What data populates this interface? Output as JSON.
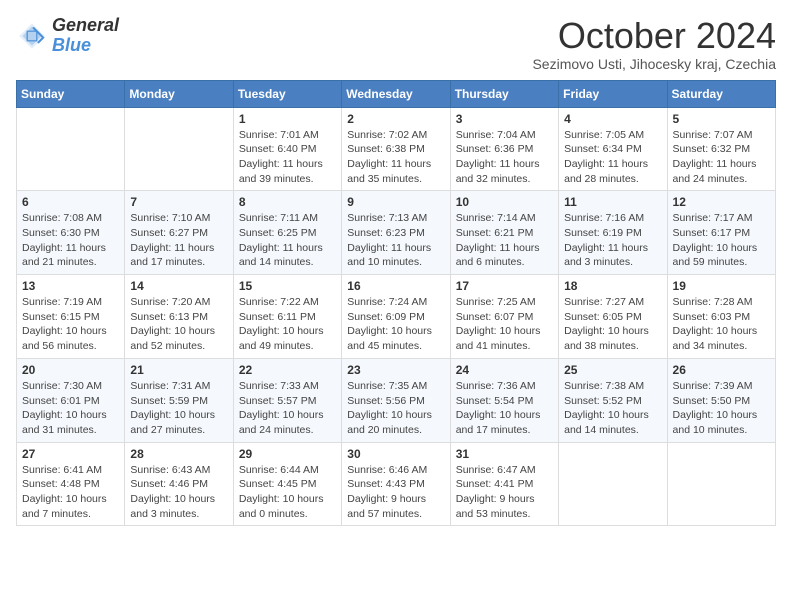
{
  "header": {
    "logo_line1": "General",
    "logo_line2": "Blue",
    "month_title": "October 2024",
    "subtitle": "Sezimovo Usti, Jihocesky kraj, Czechia"
  },
  "weekdays": [
    "Sunday",
    "Monday",
    "Tuesday",
    "Wednesday",
    "Thursday",
    "Friday",
    "Saturday"
  ],
  "weeks": [
    [
      {
        "day": "",
        "info": ""
      },
      {
        "day": "",
        "info": ""
      },
      {
        "day": "1",
        "info": "Sunrise: 7:01 AM\nSunset: 6:40 PM\nDaylight: 11 hours and 39 minutes."
      },
      {
        "day": "2",
        "info": "Sunrise: 7:02 AM\nSunset: 6:38 PM\nDaylight: 11 hours and 35 minutes."
      },
      {
        "day": "3",
        "info": "Sunrise: 7:04 AM\nSunset: 6:36 PM\nDaylight: 11 hours and 32 minutes."
      },
      {
        "day": "4",
        "info": "Sunrise: 7:05 AM\nSunset: 6:34 PM\nDaylight: 11 hours and 28 minutes."
      },
      {
        "day": "5",
        "info": "Sunrise: 7:07 AM\nSunset: 6:32 PM\nDaylight: 11 hours and 24 minutes."
      }
    ],
    [
      {
        "day": "6",
        "info": "Sunrise: 7:08 AM\nSunset: 6:30 PM\nDaylight: 11 hours and 21 minutes."
      },
      {
        "day": "7",
        "info": "Sunrise: 7:10 AM\nSunset: 6:27 PM\nDaylight: 11 hours and 17 minutes."
      },
      {
        "day": "8",
        "info": "Sunrise: 7:11 AM\nSunset: 6:25 PM\nDaylight: 11 hours and 14 minutes."
      },
      {
        "day": "9",
        "info": "Sunrise: 7:13 AM\nSunset: 6:23 PM\nDaylight: 11 hours and 10 minutes."
      },
      {
        "day": "10",
        "info": "Sunrise: 7:14 AM\nSunset: 6:21 PM\nDaylight: 11 hours and 6 minutes."
      },
      {
        "day": "11",
        "info": "Sunrise: 7:16 AM\nSunset: 6:19 PM\nDaylight: 11 hours and 3 minutes."
      },
      {
        "day": "12",
        "info": "Sunrise: 7:17 AM\nSunset: 6:17 PM\nDaylight: 10 hours and 59 minutes."
      }
    ],
    [
      {
        "day": "13",
        "info": "Sunrise: 7:19 AM\nSunset: 6:15 PM\nDaylight: 10 hours and 56 minutes."
      },
      {
        "day": "14",
        "info": "Sunrise: 7:20 AM\nSunset: 6:13 PM\nDaylight: 10 hours and 52 minutes."
      },
      {
        "day": "15",
        "info": "Sunrise: 7:22 AM\nSunset: 6:11 PM\nDaylight: 10 hours and 49 minutes."
      },
      {
        "day": "16",
        "info": "Sunrise: 7:24 AM\nSunset: 6:09 PM\nDaylight: 10 hours and 45 minutes."
      },
      {
        "day": "17",
        "info": "Sunrise: 7:25 AM\nSunset: 6:07 PM\nDaylight: 10 hours and 41 minutes."
      },
      {
        "day": "18",
        "info": "Sunrise: 7:27 AM\nSunset: 6:05 PM\nDaylight: 10 hours and 38 minutes."
      },
      {
        "day": "19",
        "info": "Sunrise: 7:28 AM\nSunset: 6:03 PM\nDaylight: 10 hours and 34 minutes."
      }
    ],
    [
      {
        "day": "20",
        "info": "Sunrise: 7:30 AM\nSunset: 6:01 PM\nDaylight: 10 hours and 31 minutes."
      },
      {
        "day": "21",
        "info": "Sunrise: 7:31 AM\nSunset: 5:59 PM\nDaylight: 10 hours and 27 minutes."
      },
      {
        "day": "22",
        "info": "Sunrise: 7:33 AM\nSunset: 5:57 PM\nDaylight: 10 hours and 24 minutes."
      },
      {
        "day": "23",
        "info": "Sunrise: 7:35 AM\nSunset: 5:56 PM\nDaylight: 10 hours and 20 minutes."
      },
      {
        "day": "24",
        "info": "Sunrise: 7:36 AM\nSunset: 5:54 PM\nDaylight: 10 hours and 17 minutes."
      },
      {
        "day": "25",
        "info": "Sunrise: 7:38 AM\nSunset: 5:52 PM\nDaylight: 10 hours and 14 minutes."
      },
      {
        "day": "26",
        "info": "Sunrise: 7:39 AM\nSunset: 5:50 PM\nDaylight: 10 hours and 10 minutes."
      }
    ],
    [
      {
        "day": "27",
        "info": "Sunrise: 6:41 AM\nSunset: 4:48 PM\nDaylight: 10 hours and 7 minutes."
      },
      {
        "day": "28",
        "info": "Sunrise: 6:43 AM\nSunset: 4:46 PM\nDaylight: 10 hours and 3 minutes."
      },
      {
        "day": "29",
        "info": "Sunrise: 6:44 AM\nSunset: 4:45 PM\nDaylight: 10 hours and 0 minutes."
      },
      {
        "day": "30",
        "info": "Sunrise: 6:46 AM\nSunset: 4:43 PM\nDaylight: 9 hours and 57 minutes."
      },
      {
        "day": "31",
        "info": "Sunrise: 6:47 AM\nSunset: 4:41 PM\nDaylight: 9 hours and 53 minutes."
      },
      {
        "day": "",
        "info": ""
      },
      {
        "day": "",
        "info": ""
      }
    ]
  ]
}
